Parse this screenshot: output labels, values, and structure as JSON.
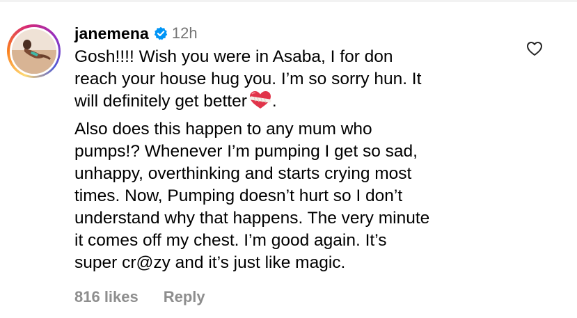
{
  "comment": {
    "username": "janemena",
    "verified_icon": "verified-badge-icon",
    "time": "12h",
    "paragraph_1": "Gosh!!!! Wish you were in Asaba, I for don\nreach your house hug you. I’m so sorry hun. It\nwill definitely get better",
    "paragraph_1_end": ".",
    "paragraph_1_emoji": "mending-heart-emoji",
    "paragraph_2": "Also does this happen to any mum who\npumps!? Whenever I’m pumping I get so sad,\nunhappy, overthinking and starts crying most\ntimes. Now, Pumping doesn’t hurt so I don’t\nunderstand why that happens. The very minute\nit comes off my chest. I’m good again. It’s\nsuper cr@zy and it’s just like magic.",
    "likes_label": "816 likes",
    "reply_label": "Reply",
    "like_icon": "heart-outline-icon"
  },
  "colors": {
    "verified_blue": "#0095f6",
    "muted_text": "#737373",
    "footer_text": "#8e8e8e",
    "story_ring": [
      "#feda75",
      "#fa7e1e",
      "#d62976",
      "#962fbf",
      "#4f5bd5"
    ]
  }
}
